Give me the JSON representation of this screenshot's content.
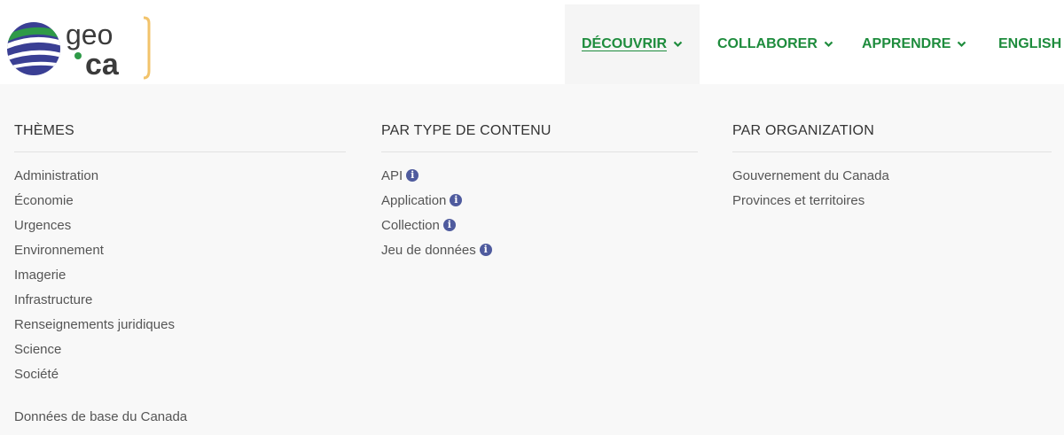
{
  "brand": {
    "logo_text_top": "geo",
    "logo_text_bottom": "ca"
  },
  "nav": [
    {
      "label": "DÉCOUVRIR",
      "active": true
    },
    {
      "label": "COLLABORER",
      "active": false
    },
    {
      "label": "APPRENDRE",
      "active": false
    },
    {
      "label": "ENGLISH",
      "active": false
    }
  ],
  "menu": {
    "themes": {
      "heading": "THÈMES",
      "items": [
        "Administration",
        "Économie",
        "Urgences",
        "Environnement",
        "Imagerie",
        "Infrastructure",
        "Renseignements juridiques",
        "Science",
        "Société"
      ],
      "extra": "Données de base du Canada"
    },
    "content_type": {
      "heading": "PAR TYPE DE CONTENU",
      "items": [
        "API",
        "Application",
        "Collection",
        "Jeu de données"
      ],
      "info_icon": "i"
    },
    "organization": {
      "heading": "PAR ORGANIZATION",
      "items": [
        "Gouvernement du Canada",
        "Provinces et territoires"
      ]
    }
  },
  "colors": {
    "accent": "#1e8c3d",
    "info": "#4f5b9e",
    "menu_bg": "#f8f8f8"
  }
}
